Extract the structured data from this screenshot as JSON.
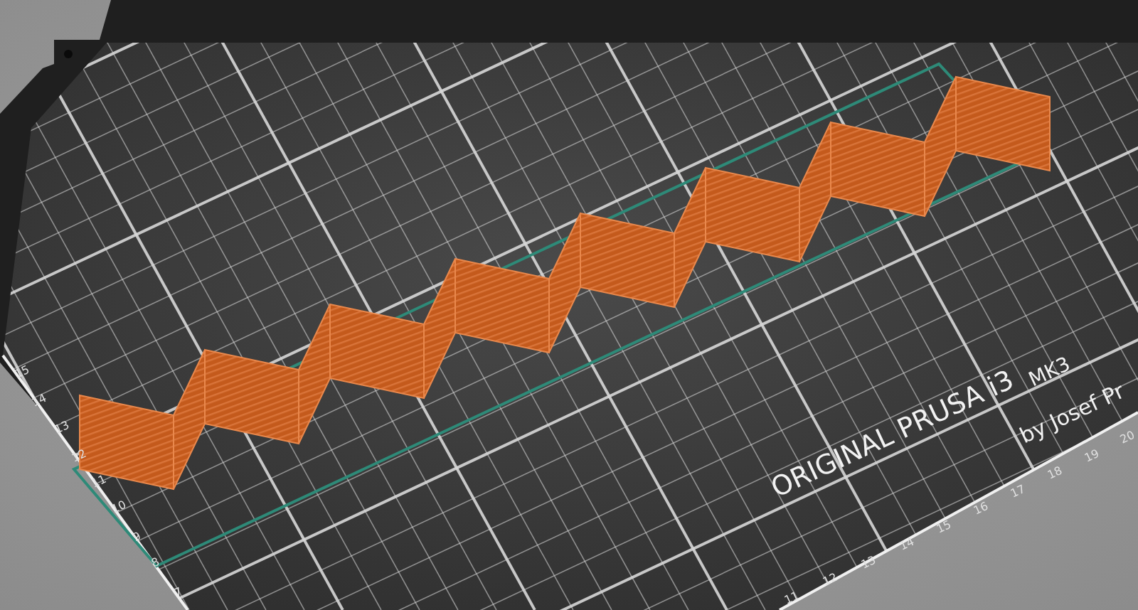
{
  "bed": {
    "logo": "ORIGINAL PRUSA i3",
    "model": "MK3",
    "byline": "by Josef Pr",
    "y_axis_labels": [
      "15",
      "14",
      "13",
      "12",
      "11",
      "10",
      "9",
      "8",
      "7"
    ],
    "x_axis_labels": [
      "11",
      "12",
      "13",
      "14",
      "15",
      "16",
      "17",
      "18",
      "19",
      "20"
    ]
  }
}
